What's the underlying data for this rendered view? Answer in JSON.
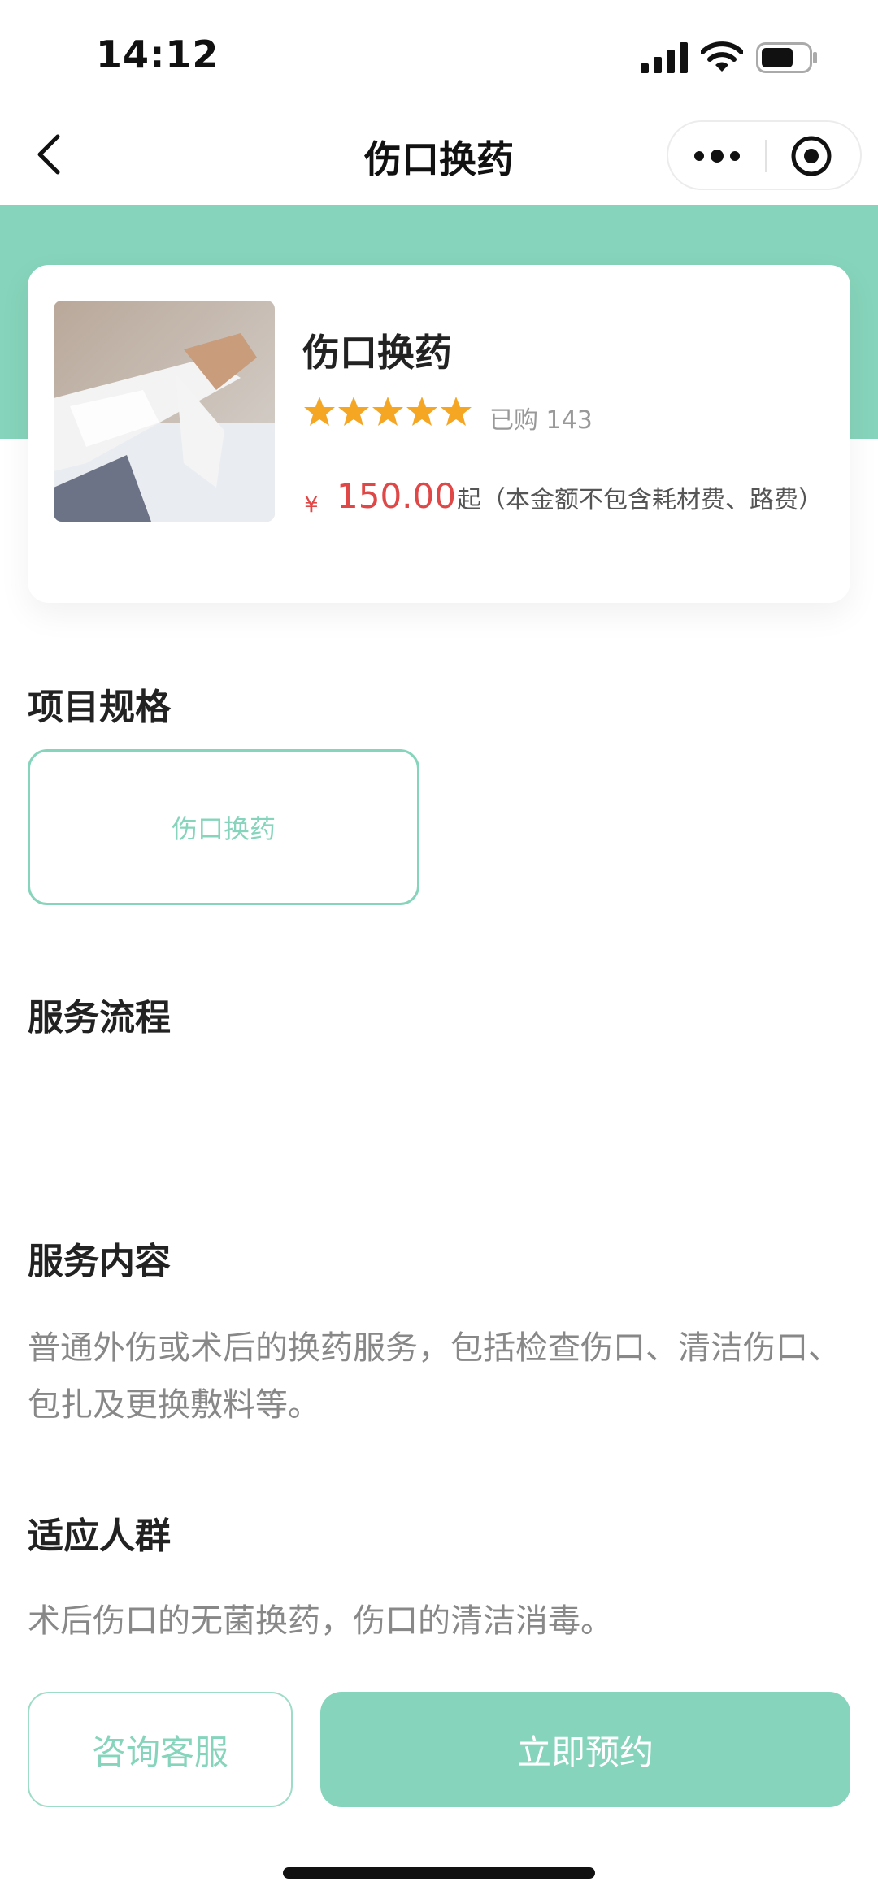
{
  "status_bar": {
    "time": "14:12"
  },
  "nav": {
    "title": "伤口换药"
  },
  "product": {
    "name": "伤口换药",
    "rating_stars": 5,
    "sold": "已购 143",
    "currency": "¥",
    "price": "150.00",
    "price_note": "起（本金额不包含耗材费、路费）"
  },
  "spec": {
    "title": "项目规格",
    "option": "伤口换药"
  },
  "flow": {
    "title": "服务流程"
  },
  "content": {
    "title": "服务内容",
    "text": "普通外伤或术后的换药服务，包括检查伤口、清洁伤口、包扎及更换敷料等。"
  },
  "crowd": {
    "title": "适应人群",
    "text": "术后伤口的无菌换药，伤口的清洁消毒。"
  },
  "actions": {
    "consult": "咨询客服",
    "book": "立即预约"
  },
  "colors": {
    "accent": "#86d4bb",
    "price": "#e04848",
    "star": "#f5a623"
  },
  "icons": [
    "signal-icon",
    "wifi-icon",
    "battery-icon",
    "back-icon",
    "more-icon",
    "target-icon",
    "star-icon"
  ]
}
